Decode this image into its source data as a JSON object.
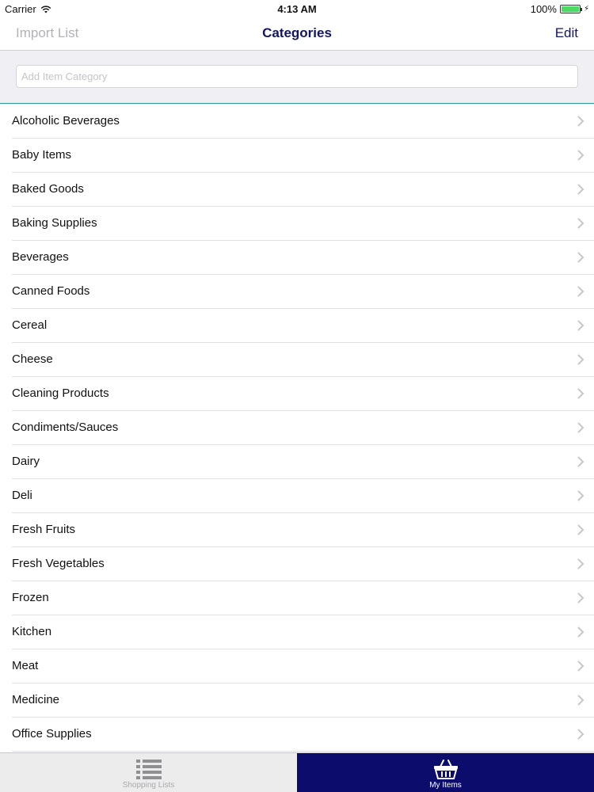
{
  "status_bar": {
    "carrier": "Carrier",
    "time": "4:13 AM",
    "battery": "100%"
  },
  "nav": {
    "left_label": "Import List",
    "title": "Categories",
    "right_label": "Edit"
  },
  "search": {
    "placeholder": "Add Item Category",
    "value": ""
  },
  "categories": [
    "Alcoholic Beverages",
    "Baby Items",
    "Baked Goods",
    "Baking Supplies",
    "Beverages",
    "Canned Foods",
    "Cereal",
    "Cheese",
    "Cleaning Products",
    "Condiments/Sauces",
    "Dairy",
    "Deli",
    "Fresh Fruits",
    "Fresh Vegetables",
    "Frozen",
    "Kitchen",
    "Meat",
    "Medicine",
    "Office Supplies"
  ],
  "tabs": [
    {
      "label": "Shopping Lists",
      "icon": "list-icon",
      "selected": false
    },
    {
      "label": "My Items",
      "icon": "basket-icon",
      "selected": true
    }
  ],
  "colors": {
    "accent": "#121563",
    "tab_selected_bg": "#0b0c6b",
    "divider_accent": "#2a9f8a"
  }
}
